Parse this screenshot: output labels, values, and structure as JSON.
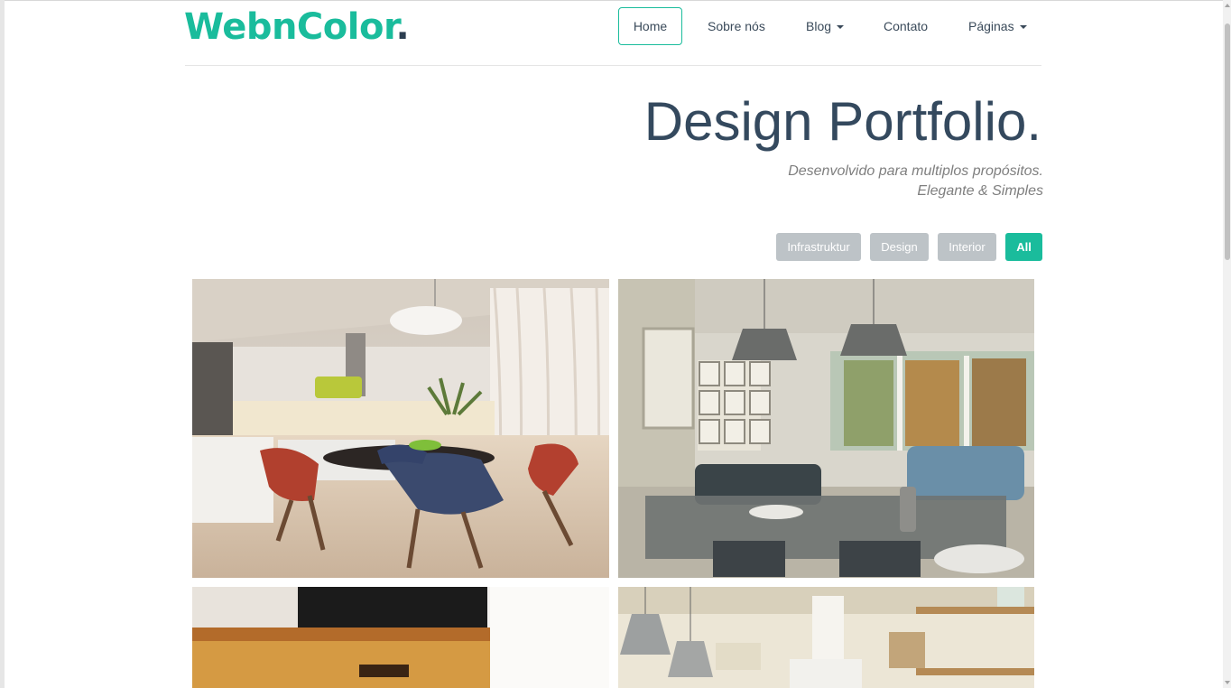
{
  "brand": {
    "name": "WebnColor",
    "dot": "."
  },
  "nav": {
    "home": "Home",
    "about": "Sobre nós",
    "blog": "Blog",
    "contact": "Contato",
    "pages": "Páginas"
  },
  "hero": {
    "title": "Design Portfolio.",
    "subtitle_line1": "Desenvolvido para multiplos propósitos.",
    "subtitle_line2": "Elegante & Simples"
  },
  "filters": {
    "infra": "Infrastruktur",
    "design": "Design",
    "interior": "Interior",
    "all": "All"
  },
  "colors": {
    "accent": "#1abc9c",
    "dark": "#2c3e50",
    "filter_inactive": "#bdc3c7"
  },
  "icons": {
    "dropdown": "chevron-down-icon"
  }
}
